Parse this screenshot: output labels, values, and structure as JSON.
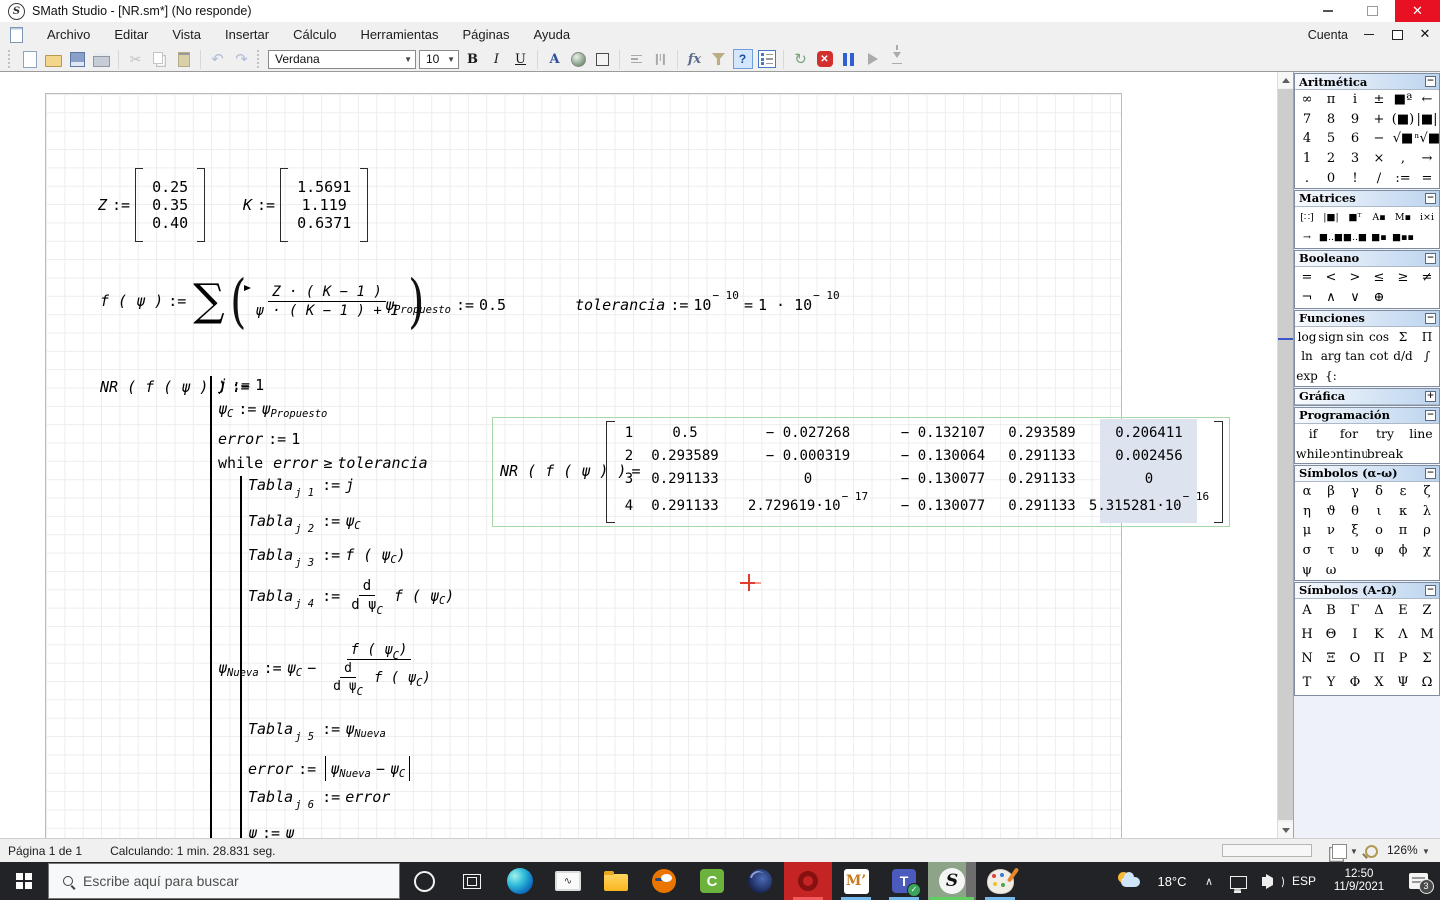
{
  "window": {
    "title": "SMath Studio - [NR.sm*] (No responde)",
    "account": "Cuenta"
  },
  "menubar": {
    "items": [
      "Archivo",
      "Editar",
      "Vista",
      "Insertar",
      "Cálculo",
      "Herramientas",
      "Páginas",
      "Ayuda"
    ]
  },
  "toolbar": {
    "font_name": "Verdana",
    "font_size": "10",
    "bold": "B",
    "italic": "I",
    "underline": "U",
    "font_color": "A",
    "fx": "fx",
    "help": "?",
    "stop_x": "✕",
    "refresh": "↻",
    "cut": "✂",
    "undo": "↶",
    "redo": "↷"
  },
  "worksheet": {
    "vec_z": {
      "name": "Z",
      "assign": ":=",
      "values": [
        "0.25",
        "0.35",
        "0.40"
      ]
    },
    "vec_k": {
      "name": "K",
      "assign": ":=",
      "values": [
        "1.5691",
        "1.119",
        "0.6371"
      ]
    },
    "f_def": {
      "lhs": "f ( ψ )",
      "assign": ":=",
      "sigma": "∑",
      "numerator": "Z · ( K − 1 )",
      "denominator": "ψ · ( K − 1 ) + 1"
    },
    "psi_prop": {
      "base": "ψ",
      "sub": "Propuesto",
      "assign": ":=",
      "value": "0.5"
    },
    "tolerance": {
      "name": "tolerancia",
      "assign": ":=",
      "base": "10",
      "exp": "− 10",
      "equals": "=",
      "rbase": "1 · 10",
      "rexp": "− 10"
    },
    "tok": {
      "nr_lhs": "NR ( f ( ψ ) )",
      "assign": ":=",
      "equals": "=",
      "j": "j",
      "one": "1",
      "psi": "ψ",
      "subC": "C",
      "subNueva": "Nueva",
      "subPropuesto": "Propuesto",
      "error": "error",
      "while": "while",
      "geq": "≥",
      "tolerancia": "tolerancia",
      "tabla": "Tabla",
      "fopen": "f ( ψ",
      "close": ")",
      "d": "d",
      "dpsi": "d ψ",
      "minus": "−"
    },
    "tsubs": [
      "j 1",
      "j 2",
      "j 3",
      "j 4",
      "j 5",
      "j 6"
    ],
    "result": {
      "rows": [
        [
          "1",
          "0.5",
          "− 0.027268",
          "− 0.132107",
          "0.293589",
          "0.206411"
        ],
        [
          "2",
          "0.293589",
          "− 0.000319",
          "− 0.130064",
          "0.291133",
          "0.002456"
        ],
        [
          "3",
          "0.291133",
          "0",
          "− 0.130077",
          "0.291133",
          "0"
        ],
        [
          "4",
          "0.291133",
          "2.729619·10",
          "− 0.130077",
          "0.291133",
          "5.315281·10"
        ]
      ],
      "exp_c3": "− 17",
      "exp_c6": "− 16"
    }
  },
  "palettes": [
    {
      "title": "Aritmética",
      "toggle": "−",
      "rows": [
        [
          "∞",
          "π",
          "i",
          "±",
          "■ª",
          "←"
        ],
        [
          "7",
          "8",
          "9",
          "+",
          "(■)",
          "|■|"
        ],
        [
          "4",
          "5",
          "6",
          "−",
          "√■",
          "ⁿ√■"
        ],
        [
          "1",
          "2",
          "3",
          "×",
          ",",
          "→"
        ],
        [
          ".",
          "0",
          "!",
          "/",
          ":=",
          "="
        ]
      ]
    },
    {
      "title": "Matrices",
      "toggle": "−",
      "rows": [
        [
          "[∷]",
          "|■|",
          "■ᵀ",
          "A▪",
          "M▪",
          "i×i"
        ],
        [
          "→",
          "[■..■]",
          "[■..■]",
          "■▪",
          "■▪▪"
        ]
      ]
    },
    {
      "title": "Booleano",
      "toggle": "−",
      "rows": [
        [
          "=",
          "<",
          ">",
          "≤",
          "≥",
          "≠"
        ],
        [
          "¬",
          "∧",
          "∨",
          "⊕"
        ]
      ]
    },
    {
      "title": "Funciones",
      "toggle": "−",
      "rows": [
        [
          "log",
          "sign",
          "sin",
          "cos",
          "Σ",
          "Π"
        ],
        [
          "ln",
          "arg",
          "tan",
          "cot",
          "d/d",
          "∫"
        ],
        [
          "exp",
          "{:"
        ]
      ]
    },
    {
      "title": "Gráfica",
      "toggle": "+",
      "rows": []
    },
    {
      "title": "Programación",
      "toggle": "−",
      "rows": [
        [
          "if",
          "for",
          "try",
          "line"
        ],
        [
          "while",
          "continue",
          "break"
        ]
      ]
    },
    {
      "title": "Símbolos (α-ω)",
      "toggle": "−",
      "rows": [
        [
          "α",
          "β",
          "γ",
          "δ",
          "ε",
          "ζ"
        ],
        [
          "η",
          "ϑ",
          "θ",
          "ι",
          "κ",
          "λ"
        ],
        [
          "μ",
          "ν",
          "ξ",
          "ο",
          "π",
          "ρ"
        ],
        [
          "σ",
          "τ",
          "υ",
          "φ",
          "ϕ",
          "χ"
        ],
        [
          "ψ",
          "ω"
        ]
      ]
    },
    {
      "title": "Símbolos (Α-Ω)",
      "toggle": "−",
      "rows": [
        [
          "Α",
          "Β",
          "Γ",
          "Δ",
          "Ε",
          "Ζ"
        ],
        [
          "Η",
          "Θ",
          "Ι",
          "Κ",
          "Λ",
          "Μ"
        ],
        [
          "Ν",
          "Ξ",
          "Ο",
          "Π",
          "Ρ",
          "Σ"
        ],
        [
          "Τ",
          "Υ",
          "Φ",
          "Χ",
          "Ψ",
          "Ω"
        ]
      ]
    }
  ],
  "statusbar": {
    "page": "Página 1 de 1",
    "status": "Calculando: 1 min. 28.831 seg.",
    "zoom": "126%"
  },
  "taskbar": {
    "search_placeholder": "Escribe aquí para buscar",
    "apps": [
      "edge",
      "task-manager",
      "file-explorer",
      "blender",
      "camtasia",
      "cinema-4d",
      "opera",
      "mendeley",
      "teams",
      "smath-studio",
      "paint-3d"
    ],
    "letters": {
      "camtasia": "C",
      "mendeley": "M’",
      "teams": "T",
      "smath": "S"
    },
    "tray": {
      "temperature": "18°C",
      "language": "ESP",
      "time": "12:50",
      "date": "11/9/2021",
      "notification_count": "3"
    }
  },
  "colors": {
    "close_button": "#e81123",
    "selection_border": "#a6d7a6",
    "selection_band": "#dde3ef",
    "progress_green": "#2db52d",
    "taskbar_bg": "#222326",
    "active_app_underline": "#5fd05f"
  }
}
